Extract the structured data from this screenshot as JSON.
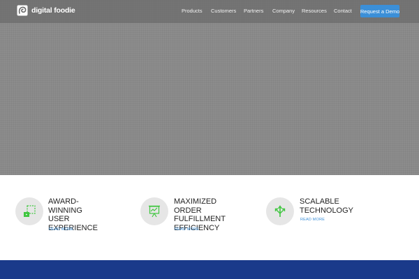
{
  "header": {
    "logo_text": "digital foodie",
    "nav": [
      "Products",
      "Customers",
      "Partners",
      "Company",
      "Resources",
      "Contact"
    ],
    "cta_label": "Request a Demo"
  },
  "features": [
    {
      "title": "AWARD-WINNING\nUSER\nEXPERIENCE",
      "link": "READ MORE",
      "icon": "hand-tap-icon"
    },
    {
      "title": "MAXIMIZED ORDER\nFULFILLMENT\nEFFICIENCY",
      "link": "READ MORE",
      "icon": "presentation-chart-icon"
    },
    {
      "title": "SCALABLE TECHNOLOGY",
      "link": "READ MORE",
      "icon": "branching-arrows-icon"
    }
  ],
  "colors": {
    "accent": "#3b8fd8",
    "icon_green": "#3fc63f",
    "hero_gray": "#8c8c8c",
    "footer_blue": "#1a3a8a"
  }
}
